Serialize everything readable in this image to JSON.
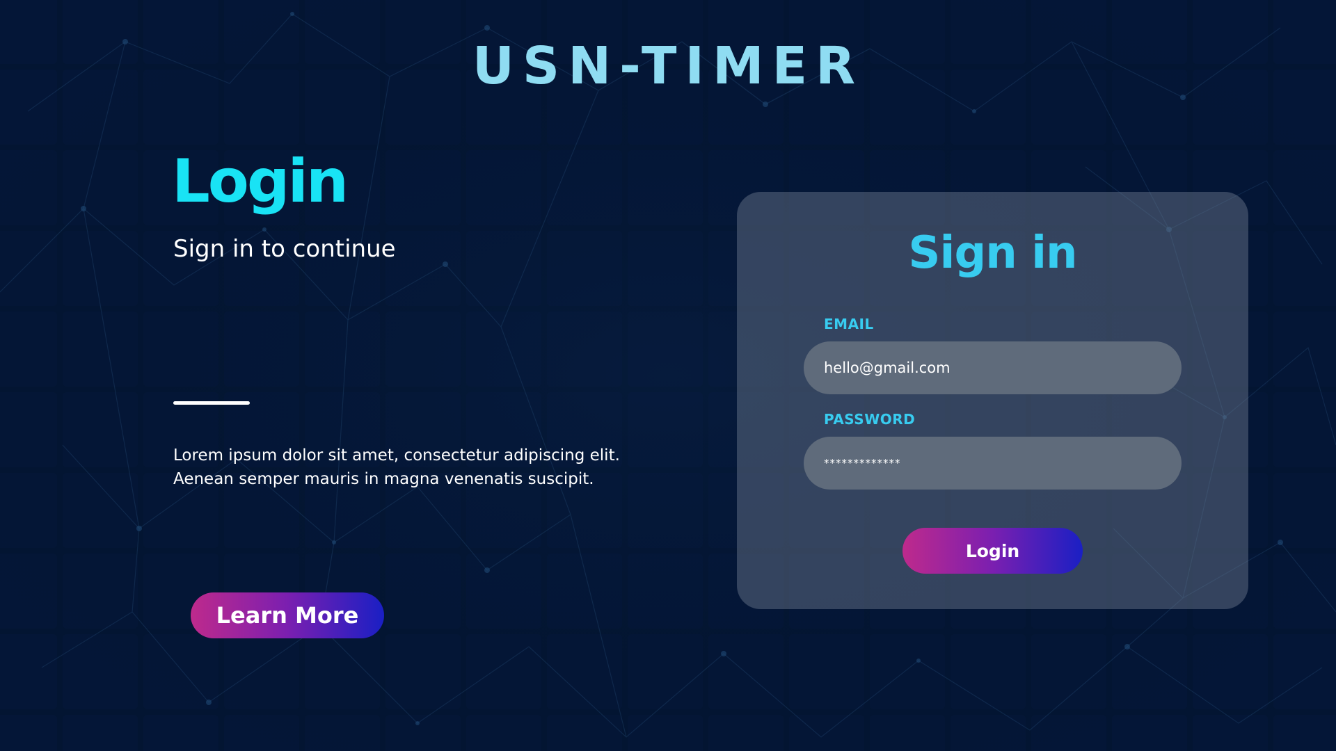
{
  "brand": {
    "name": "USN-TIMER"
  },
  "hero": {
    "title": "Login",
    "subtitle": "Sign in to continue",
    "description_line1": "Lorem ipsum dolor sit amet, consectetur adipiscing elit.",
    "description_line2": "Aenean semper mauris in magna venenatis suscipit.",
    "learn_more_label": "Learn More"
  },
  "signin_card": {
    "title": "Sign in",
    "email_label": "EMAIL",
    "email_value": "hello@gmail.com",
    "password_label": "PASSWORD",
    "password_value": "*************",
    "login_label": "Login"
  },
  "colors": {
    "background": "#031532",
    "accent_cyan": "#19e3f5",
    "label_cyan": "#38ccf0",
    "brand_text": "#8fdcf2",
    "gradient_start": "#be2a8c",
    "gradient_end": "#1a1fc4",
    "card_bg": "#4a5668",
    "field_bg": "#5f6b7b"
  }
}
